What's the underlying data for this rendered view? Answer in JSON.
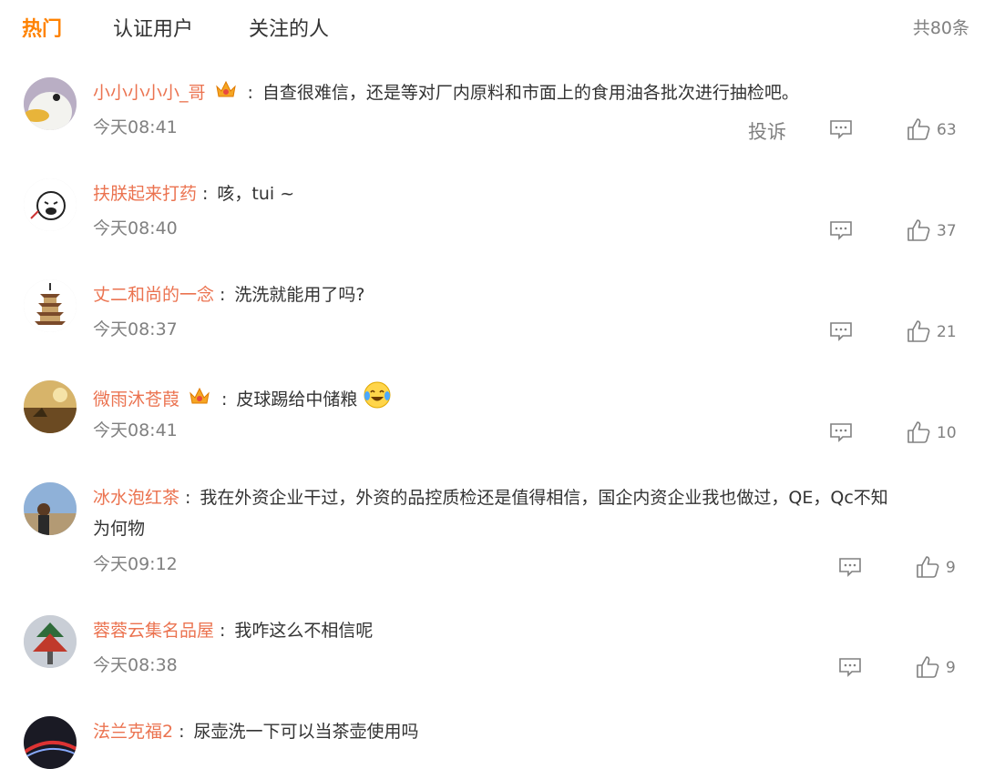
{
  "tabs": [
    {
      "label": "热门",
      "active": true
    },
    {
      "label": "认证用户",
      "active": false
    },
    {
      "label": "关注的人",
      "active": false
    }
  ],
  "total": "共80条",
  "actions": {
    "report_label": "投诉"
  },
  "colors": {
    "accent": "#ff8200",
    "username": "#eb7350",
    "muted": "#808080"
  },
  "comments": [
    {
      "user": "小小小小小_哥",
      "vip": true,
      "text": "自查很难信，还是等对厂内原料和市面上的食用油各批次进行抽检吧。",
      "time": "今天08:41",
      "likes": "63"
    },
    {
      "user": "扶朕起来打药",
      "vip": false,
      "text": "咳，tui ~",
      "time": "今天08:40",
      "likes": "37"
    },
    {
      "user": "丈二和尚的一念",
      "vip": false,
      "text": "洗洗就能用了吗?",
      "time": "今天08:37",
      "likes": "21"
    },
    {
      "user": "微雨沐苍葭",
      "vip": true,
      "text": "皮球踢给中储粮",
      "emoji": "laugh-cry-emoji",
      "time": "今天08:41",
      "likes": "10"
    },
    {
      "user": "冰水泡红茶",
      "vip": false,
      "text": "我在外资企业干过，外资的品控质检还是值得相信，国企内资企业我也做过，QE，Qc不知",
      "text2": "为何物",
      "time": "今天09:12",
      "likes": "9"
    },
    {
      "user": "蓉蓉云集名品屋",
      "vip": false,
      "text": "我咋这么不相信呢",
      "time": "今天08:38",
      "likes": "9"
    },
    {
      "user": "法兰克福2",
      "vip": false,
      "text": "尿壶洗一下可以当茶壶使用吗"
    }
  ]
}
